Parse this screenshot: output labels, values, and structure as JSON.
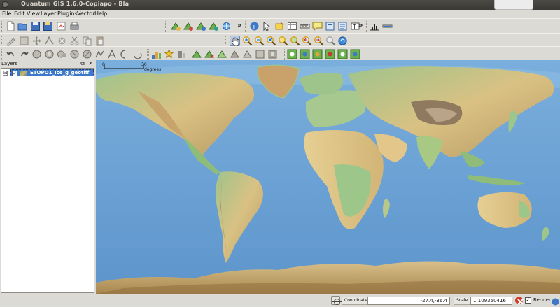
{
  "window": {
    "title": "Quantum GIS 1.6.0-Copiapo - Bla"
  },
  "menu": [
    "File",
    "Edit",
    "View",
    "Layer",
    "Plugins",
    "Vector",
    "Help"
  ],
  "toolbar": {
    "overflow_label": "»"
  },
  "layers_panel": {
    "title": "Layers",
    "float_label": "⧉",
    "close_label": "✕",
    "expander": "⊟",
    "check": "✓",
    "layers": [
      {
        "name": "ETOPO1_Ice_g_geotiff",
        "visible": true
      }
    ]
  },
  "map": {
    "scalebar_start": "0",
    "scalebar_end": "30",
    "scalebar_unit": "degrees"
  },
  "status": {
    "coordinate_label": "Coordinate:",
    "coordinate_value": "-27.4,-36.4",
    "scale_label": "Scale",
    "scale_value": "1:109350416",
    "render_label": "Render",
    "render_checked": true
  }
}
